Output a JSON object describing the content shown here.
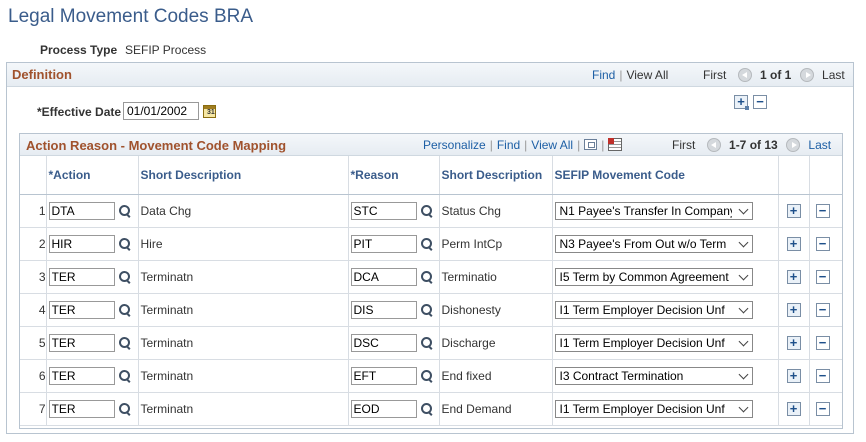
{
  "page": {
    "title": "Legal Movement Codes BRA"
  },
  "process_type": {
    "label": "Process Type",
    "value": "SEFIP Process"
  },
  "definition": {
    "title": "Definition",
    "find": "Find",
    "view_all": "View All",
    "first": "First",
    "count": "1 of 1",
    "last": "Last",
    "effective_date_label": "*Effective Date",
    "effective_date": "01/01/2002",
    "add_symbol": "+",
    "remove_symbol": "−"
  },
  "grid": {
    "title": "Action Reason - Movement Code Mapping",
    "personalize": "Personalize",
    "find": "Find",
    "view_all": "View All",
    "first": "First",
    "count": "1-7 of 13",
    "last": "Last",
    "columns": {
      "action": "*Action",
      "short_desc_1": "Short Description",
      "reason": "*Reason",
      "short_desc_2": "Short Description",
      "sefip": "SEFIP Movement Code"
    },
    "rows": [
      {
        "num": "1",
        "action": "DTA",
        "action_desc": "Data Chg",
        "reason": "STC",
        "reason_desc": "Status Chg",
        "sefip": "N1 Payee's Transfer In Company"
      },
      {
        "num": "2",
        "action": "HIR",
        "action_desc": "Hire",
        "reason": "PIT",
        "reason_desc": "Perm IntCp",
        "sefip": "N3 Payee's From Out w/o Term"
      },
      {
        "num": "3",
        "action": "TER",
        "action_desc": "Terminatn",
        "reason": "DCA",
        "reason_desc": "Terminatio",
        "sefip": "I5 Term by Common Agreement"
      },
      {
        "num": "4",
        "action": "TER",
        "action_desc": "Terminatn",
        "reason": "DIS",
        "reason_desc": "Dishonesty",
        "sefip": "I1 Term Employer Decision Unf"
      },
      {
        "num": "5",
        "action": "TER",
        "action_desc": "Terminatn",
        "reason": "DSC",
        "reason_desc": "Discharge",
        "sefip": "I1 Term Employer Decision Unf"
      },
      {
        "num": "6",
        "action": "TER",
        "action_desc": "Terminatn",
        "reason": "EFT",
        "reason_desc": "End fixed",
        "sefip": "I3 Contract Termination"
      },
      {
        "num": "7",
        "action": "TER",
        "action_desc": "Terminatn",
        "reason": "EOD",
        "reason_desc": "End Demand",
        "sefip": "I1 Term Employer Decision Unf"
      }
    ],
    "add_symbol": "+",
    "remove_symbol": "−"
  }
}
